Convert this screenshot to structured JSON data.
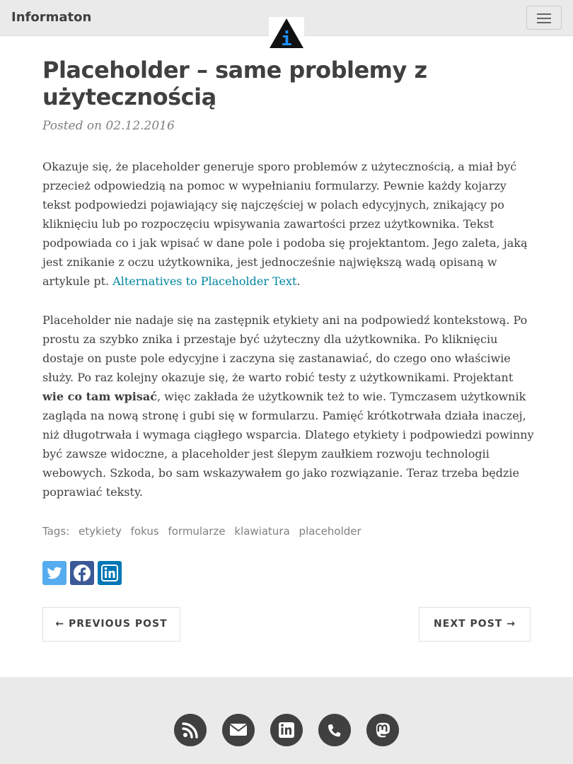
{
  "navbar": {
    "brand": "Informaton",
    "menu_icon": "hamburger-menu-icon",
    "logo_icon": "info-triangle-logo",
    "logo_letter": "i"
  },
  "post": {
    "title": "Placeholder – same problemy z użytecznością",
    "posted_label": "Posted on 02.12.2016",
    "paragraph1_text": "Okazuje się, że placeholder generuje sporo problemów z użytecznością, a miał być przecież odpowiedzią na pomoc w wypełnianiu formularzy. Pewnie każdy kojarzy tekst podpowiedzi pojawiający się najczęściej w polach edycyjnych, znikający po kliknięciu lub po rozpoczęciu wpisywania zawartości przez użytkownika. Tekst podpowiada co i jak wpisać w dane pole i podoba się projektantom. Jego zaleta, jaką jest znikanie z oczu użytkownika, jest jednocześnie największą wadą opisaną w artykule pt. ",
    "paragraph1_link": "Alternatives to Placeholder Text",
    "paragraph1_end": ".",
    "paragraph2_start": "Placeholder nie nadaje się na zastępnik etykiety ani na podpowiedź kontekstową. Po prostu za szybko znika i przestaje być użyteczny dla użytkownika. Po kliknięciu dostaje on puste pole edycyjne i zaczyna się zastanawiać, do czego ono właściwie służy. Po raz kolejny okazuje się, że warto robić testy z użytkownikami. Projektant ",
    "paragraph2_bold": "wie co tam wpisać",
    "paragraph2_end": ", więc zakłada że użytkownik też to wie. Tymczasem użytkownik zagląda na nową stronę i gubi się w formularzu. Pamięć krótkotrwała działa inaczej, niż długotrwała i wymaga ciągłego wsparcia. Dlatego etykiety i podpowiedzi powinny być zawsze widoczne, a placeholder jest ślepym zaułkiem rozwoju technologii webowych. Szkoda, bo sam wskazywałem go jako rozwiązanie. Teraz trzeba będzie poprawiać teksty."
  },
  "tags": {
    "label": "Tags:",
    "items": [
      "etykiety",
      "fokus",
      "formularze",
      "klawiatura",
      "placeholder"
    ]
  },
  "share": {
    "icons": [
      "twitter-icon",
      "facebook-icon",
      "linkedin-icon"
    ],
    "colors": {
      "twitter": "#55acee",
      "facebook": "#3b5998",
      "linkedin": "#0077b5"
    }
  },
  "pager": {
    "previous": "← PREVIOUS POST",
    "next": "NEXT POST →"
  },
  "footer": {
    "icons": [
      "rss-icon",
      "envelope-icon",
      "linkedin-icon",
      "phone-icon",
      "mastodon-icon"
    ]
  }
}
